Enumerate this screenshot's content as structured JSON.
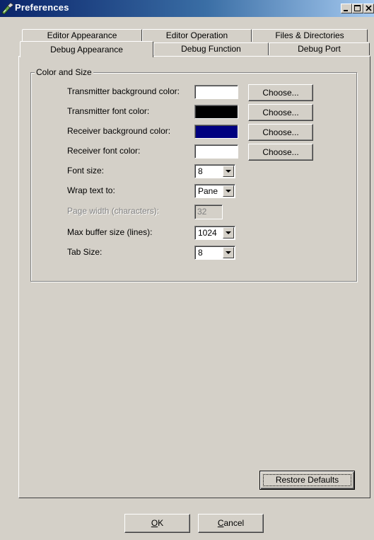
{
  "window": {
    "title": "Preferences"
  },
  "tabs": {
    "row1": [
      {
        "label": "Editor Appearance"
      },
      {
        "label": "Editor Operation"
      },
      {
        "label": "Files & Directories"
      }
    ],
    "row2": [
      {
        "label": "Debug Appearance",
        "selected": true
      },
      {
        "label": "Debug Function"
      },
      {
        "label": "Debug Port"
      }
    ]
  },
  "group": {
    "legend": "Color and Size",
    "transmitter_bg": {
      "label": "Transmitter background color:",
      "color": "#ffffff",
      "button": "Choose..."
    },
    "transmitter_font": {
      "label": "Transmitter font color:",
      "color": "#000000",
      "button": "Choose..."
    },
    "receiver_bg": {
      "label": "Receiver background color:",
      "color": "#000080",
      "button": "Choose..."
    },
    "receiver_font": {
      "label": "Receiver font color:",
      "color": "#ffffff",
      "button": "Choose..."
    },
    "font_size": {
      "label": "Font size:",
      "value": "8"
    },
    "wrap_text": {
      "label": "Wrap text to:",
      "value": "Pane"
    },
    "page_width": {
      "label": "Page width (characters):",
      "value": "32",
      "disabled": true
    },
    "max_buffer": {
      "label": "Max buffer size (lines):",
      "value": "1024"
    },
    "tab_size": {
      "label": "Tab Size:",
      "value": "8"
    }
  },
  "restore_defaults": "Restore Defaults",
  "footer": {
    "ok": {
      "mnemonic": "O",
      "rest": "K"
    },
    "cancel": {
      "mnemonic": "C",
      "rest": "ancel"
    }
  }
}
